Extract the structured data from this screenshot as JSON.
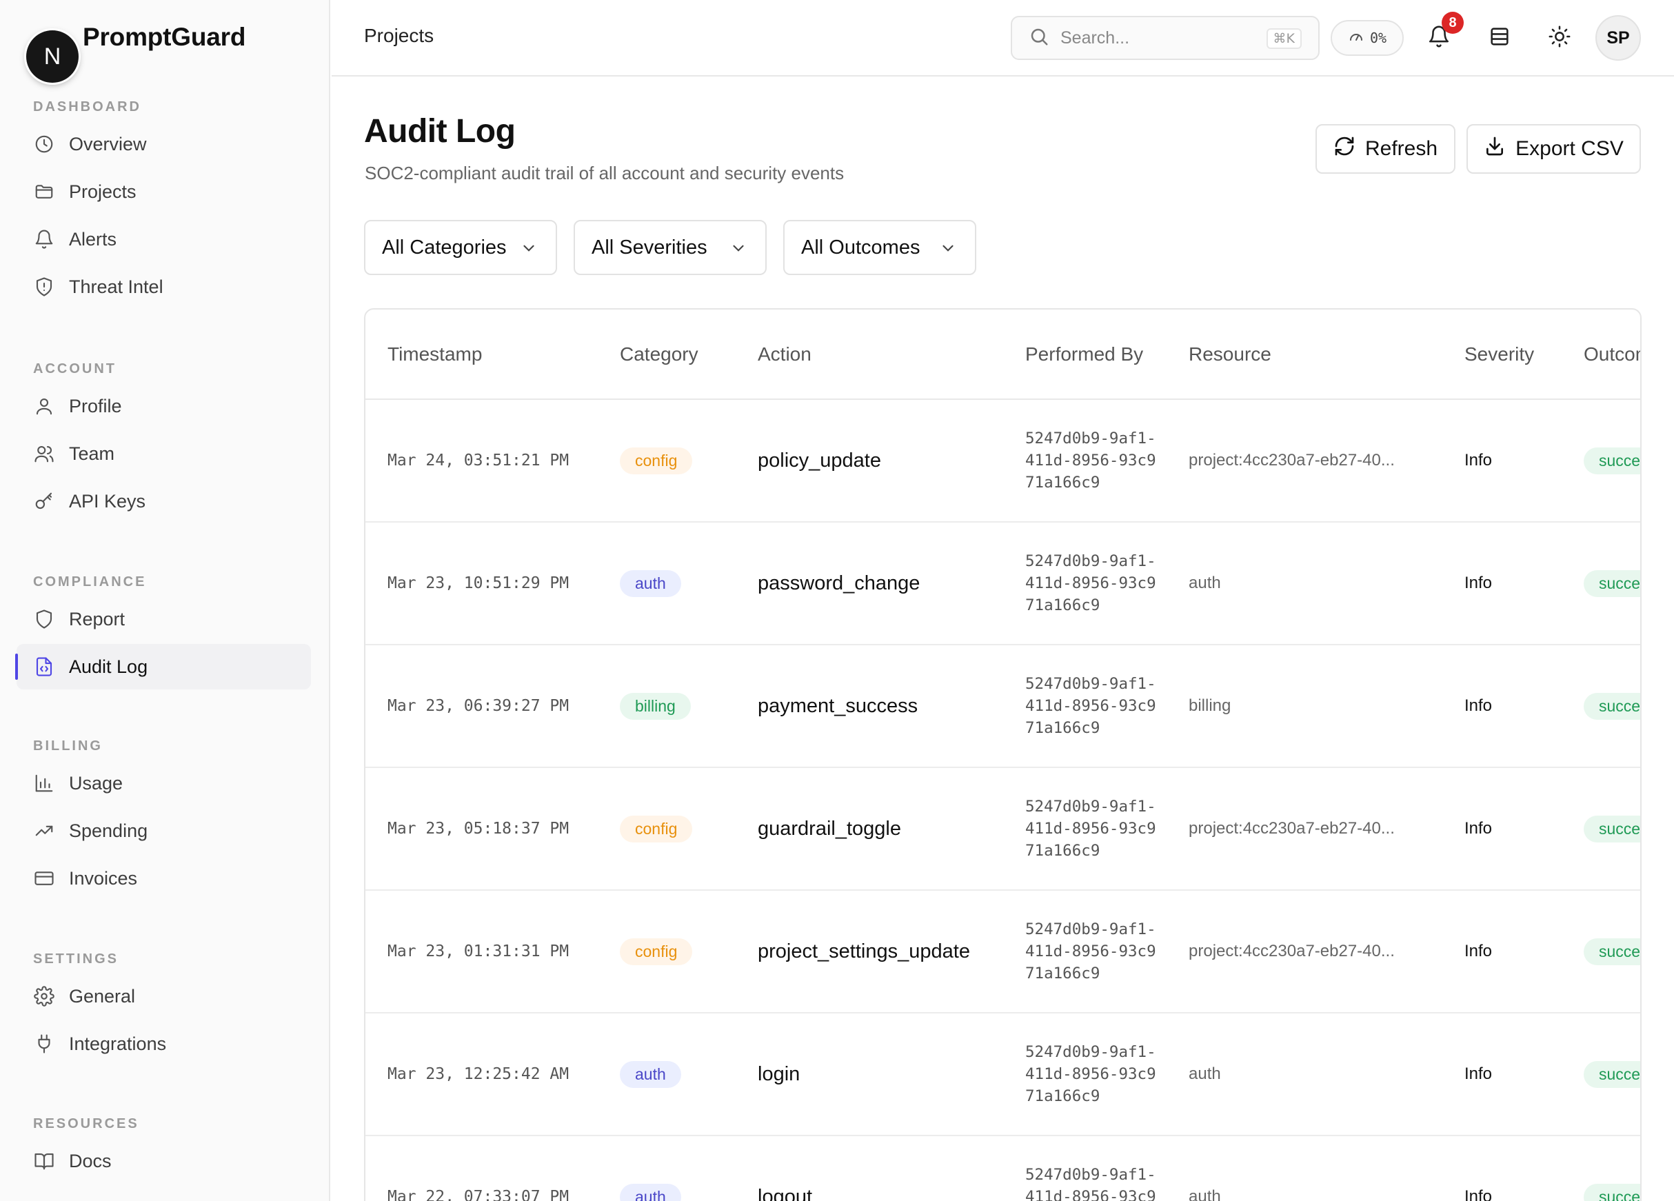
{
  "brand": {
    "logo_letter": "N",
    "name": "PromptGuard"
  },
  "sidebar": {
    "sections": [
      {
        "heading": "DASHBOARD",
        "items": [
          {
            "label": "Overview",
            "icon": "clock-icon"
          },
          {
            "label": "Projects",
            "icon": "folder-icon"
          },
          {
            "label": "Alerts",
            "icon": "bell-icon"
          },
          {
            "label": "Threat Intel",
            "icon": "shield-alert-icon"
          }
        ]
      },
      {
        "heading": "ACCOUNT",
        "items": [
          {
            "label": "Profile",
            "icon": "user-icon"
          },
          {
            "label": "Team",
            "icon": "users-icon"
          },
          {
            "label": "API Keys",
            "icon": "key-icon"
          }
        ]
      },
      {
        "heading": "COMPLIANCE",
        "items": [
          {
            "label": "Report",
            "icon": "shield-icon"
          },
          {
            "label": "Audit Log",
            "icon": "file-code-icon",
            "active": true
          }
        ]
      },
      {
        "heading": "BILLING",
        "items": [
          {
            "label": "Usage",
            "icon": "bar-chart-icon"
          },
          {
            "label": "Spending",
            "icon": "trending-up-icon"
          },
          {
            "label": "Invoices",
            "icon": "credit-card-icon"
          }
        ]
      },
      {
        "heading": "SETTINGS",
        "items": [
          {
            "label": "General",
            "icon": "gear-icon"
          },
          {
            "label": "Integrations",
            "icon": "plug-icon"
          }
        ]
      },
      {
        "heading": "RESOURCES",
        "items": [
          {
            "label": "Docs",
            "icon": "book-icon"
          }
        ]
      }
    ]
  },
  "topbar": {
    "breadcrumb": "Projects",
    "search_placeholder": "Search...",
    "search_shortcut": "⌘K",
    "usage_percent": "0%",
    "notification_count": "8",
    "user_initials": "SP"
  },
  "page": {
    "title": "Audit Log",
    "subtitle": "SOC2-compliant audit trail of all account and security events",
    "refresh_label": "Refresh",
    "export_label": "Export CSV"
  },
  "filters": {
    "category": "All Categories",
    "severity": "All Severities",
    "outcome": "All Outcomes"
  },
  "table": {
    "columns": [
      "Timestamp",
      "Category",
      "Action",
      "Performed By",
      "Resource",
      "Severity",
      "Outcome"
    ],
    "rows": [
      {
        "timestamp": "Mar 24, 03:51:21 PM",
        "category": "config",
        "action": "policy_update",
        "performed_by": "5247d0b9-9af1-411d-8956-93c971a166c9",
        "resource": "project:4cc230a7-eb27-40...",
        "severity": "Info",
        "outcome": "success"
      },
      {
        "timestamp": "Mar 23, 10:51:29 PM",
        "category": "auth",
        "action": "password_change",
        "performed_by": "5247d0b9-9af1-411d-8956-93c971a166c9",
        "resource": "auth",
        "severity": "Info",
        "outcome": "success"
      },
      {
        "timestamp": "Mar 23, 06:39:27 PM",
        "category": "billing",
        "action": "payment_success",
        "performed_by": "5247d0b9-9af1-411d-8956-93c971a166c9",
        "resource": "billing",
        "severity": "Info",
        "outcome": "success"
      },
      {
        "timestamp": "Mar 23, 05:18:37 PM",
        "category": "config",
        "action": "guardrail_toggle",
        "performed_by": "5247d0b9-9af1-411d-8956-93c971a166c9",
        "resource": "project:4cc230a7-eb27-40...",
        "severity": "Info",
        "outcome": "success"
      },
      {
        "timestamp": "Mar 23, 01:31:31 PM",
        "category": "config",
        "action": "project_settings_update",
        "performed_by": "5247d0b9-9af1-411d-8956-93c971a166c9",
        "resource": "project:4cc230a7-eb27-40...",
        "severity": "Info",
        "outcome": "success"
      },
      {
        "timestamp": "Mar 23, 12:25:42 AM",
        "category": "auth",
        "action": "login",
        "performed_by": "5247d0b9-9af1-411d-8956-93c971a166c9",
        "resource": "auth",
        "severity": "Info",
        "outcome": "success"
      },
      {
        "timestamp": "Mar 22, 07:33:07 PM",
        "category": "auth",
        "action": "logout",
        "performed_by": "5247d0b9-9af1-411d-8956-93c971a166c9",
        "resource": "auth",
        "severity": "Info",
        "outcome": "success"
      }
    ]
  },
  "colors": {
    "accent": "#4f46e5",
    "config": "#e8900c",
    "auth": "#4a47c8",
    "billing": "#1f9a55",
    "notification": "#dc2626"
  }
}
